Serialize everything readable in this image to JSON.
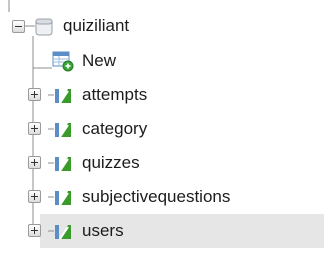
{
  "database": {
    "name": "quiziliant"
  },
  "items": [
    {
      "label": "New",
      "icon": "new-table-icon"
    },
    {
      "label": "attempts",
      "icon": "table-icon"
    },
    {
      "label": "category",
      "icon": "table-icon"
    },
    {
      "label": "quizzes",
      "icon": "table-icon"
    },
    {
      "label": "subjectivequestions",
      "icon": "table-icon"
    },
    {
      "label": "users",
      "icon": "table-icon"
    }
  ],
  "colors": {
    "row_highlight": "#e6e6e6",
    "tree_line": "#8c8c8c",
    "table_icon_green": "#3a9a2a",
    "table_icon_blue": "#5b8ec7"
  }
}
